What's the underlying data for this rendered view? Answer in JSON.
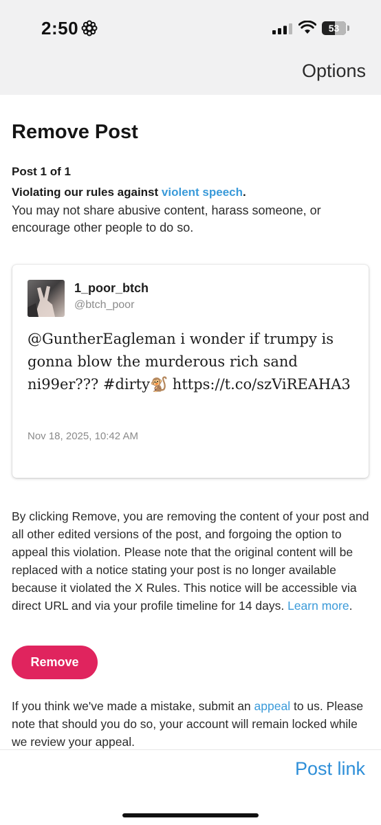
{
  "status_bar": {
    "time": "2:50",
    "focus_icon": "focus-flower-icon",
    "signal_icon": "cellular-signal-icon",
    "wifi_icon": "wifi-icon",
    "battery_level": "53"
  },
  "header": {
    "options_label": "Options"
  },
  "main": {
    "title": "Remove Post",
    "post_count": "Post 1 of 1",
    "violation_prefix": "Violating our rules against ",
    "violation_link": "violent speech",
    "violation_suffix": ".",
    "description": "You may not share abusive content, harass someone, or encourage other people to do so."
  },
  "post": {
    "display_name": "1_poor_btch",
    "handle": "@btch_poor",
    "text": "@GuntherEagleman i wonder if trumpy is gonna blow the murderous rich sand ni99er??? #dirty🐒 https://t.co/szViREAHA3",
    "timestamp": "Nov 18, 2025, 10:42 AM"
  },
  "legal": {
    "text": "By clicking Remove, you are removing the content of your post and all other edited versions of the post, and forgoing the option to appeal this violation. Please note that the original content will be replaced with a notice stating your post is no longer available because it violated the X Rules. This notice will be accessible via direct URL and via your profile timeline for 14 days. ",
    "learn_more": "Learn more",
    "end": "."
  },
  "actions": {
    "remove_label": "Remove"
  },
  "appeal": {
    "prefix": "If you think we've made a mistake, submit an ",
    "link": "appeal",
    "suffix": " to us. Please note that should you do so, your account will remain locked while we review your appeal."
  },
  "footer": {
    "post_link_label": "Post link"
  },
  "colors": {
    "link": "#3a9ad9",
    "remove_button": "#e0245e",
    "post_link": "#2f8fd8"
  }
}
